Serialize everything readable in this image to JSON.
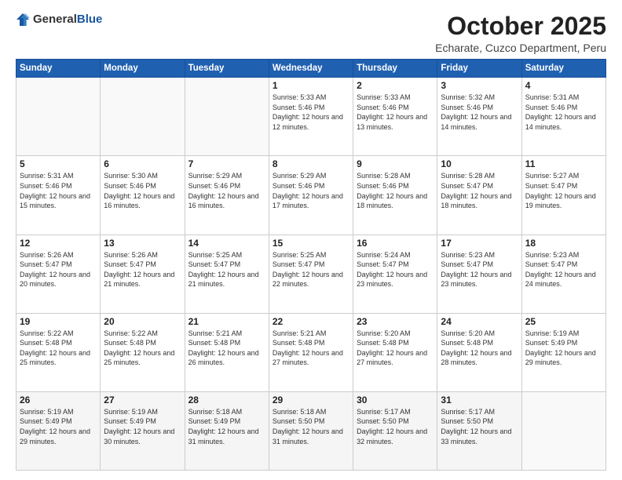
{
  "header": {
    "logo_general": "General",
    "logo_blue": "Blue",
    "month": "October 2025",
    "location": "Echarate, Cuzco Department, Peru"
  },
  "weekdays": [
    "Sunday",
    "Monday",
    "Tuesday",
    "Wednesday",
    "Thursday",
    "Friday",
    "Saturday"
  ],
  "weeks": [
    [
      {
        "day": "",
        "detail": ""
      },
      {
        "day": "",
        "detail": ""
      },
      {
        "day": "",
        "detail": ""
      },
      {
        "day": "1",
        "detail": "Sunrise: 5:33 AM\nSunset: 5:46 PM\nDaylight: 12 hours\nand 12 minutes."
      },
      {
        "day": "2",
        "detail": "Sunrise: 5:33 AM\nSunset: 5:46 PM\nDaylight: 12 hours\nand 13 minutes."
      },
      {
        "day": "3",
        "detail": "Sunrise: 5:32 AM\nSunset: 5:46 PM\nDaylight: 12 hours\nand 14 minutes."
      },
      {
        "day": "4",
        "detail": "Sunrise: 5:31 AM\nSunset: 5:46 PM\nDaylight: 12 hours\nand 14 minutes."
      }
    ],
    [
      {
        "day": "5",
        "detail": "Sunrise: 5:31 AM\nSunset: 5:46 PM\nDaylight: 12 hours\nand 15 minutes."
      },
      {
        "day": "6",
        "detail": "Sunrise: 5:30 AM\nSunset: 5:46 PM\nDaylight: 12 hours\nand 16 minutes."
      },
      {
        "day": "7",
        "detail": "Sunrise: 5:29 AM\nSunset: 5:46 PM\nDaylight: 12 hours\nand 16 minutes."
      },
      {
        "day": "8",
        "detail": "Sunrise: 5:29 AM\nSunset: 5:46 PM\nDaylight: 12 hours\nand 17 minutes."
      },
      {
        "day": "9",
        "detail": "Sunrise: 5:28 AM\nSunset: 5:46 PM\nDaylight: 12 hours\nand 18 minutes."
      },
      {
        "day": "10",
        "detail": "Sunrise: 5:28 AM\nSunset: 5:47 PM\nDaylight: 12 hours\nand 18 minutes."
      },
      {
        "day": "11",
        "detail": "Sunrise: 5:27 AM\nSunset: 5:47 PM\nDaylight: 12 hours\nand 19 minutes."
      }
    ],
    [
      {
        "day": "12",
        "detail": "Sunrise: 5:26 AM\nSunset: 5:47 PM\nDaylight: 12 hours\nand 20 minutes."
      },
      {
        "day": "13",
        "detail": "Sunrise: 5:26 AM\nSunset: 5:47 PM\nDaylight: 12 hours\nand 21 minutes."
      },
      {
        "day": "14",
        "detail": "Sunrise: 5:25 AM\nSunset: 5:47 PM\nDaylight: 12 hours\nand 21 minutes."
      },
      {
        "day": "15",
        "detail": "Sunrise: 5:25 AM\nSunset: 5:47 PM\nDaylight: 12 hours\nand 22 minutes."
      },
      {
        "day": "16",
        "detail": "Sunrise: 5:24 AM\nSunset: 5:47 PM\nDaylight: 12 hours\nand 23 minutes."
      },
      {
        "day": "17",
        "detail": "Sunrise: 5:23 AM\nSunset: 5:47 PM\nDaylight: 12 hours\nand 23 minutes."
      },
      {
        "day": "18",
        "detail": "Sunrise: 5:23 AM\nSunset: 5:47 PM\nDaylight: 12 hours\nand 24 minutes."
      }
    ],
    [
      {
        "day": "19",
        "detail": "Sunrise: 5:22 AM\nSunset: 5:48 PM\nDaylight: 12 hours\nand 25 minutes."
      },
      {
        "day": "20",
        "detail": "Sunrise: 5:22 AM\nSunset: 5:48 PM\nDaylight: 12 hours\nand 25 minutes."
      },
      {
        "day": "21",
        "detail": "Sunrise: 5:21 AM\nSunset: 5:48 PM\nDaylight: 12 hours\nand 26 minutes."
      },
      {
        "day": "22",
        "detail": "Sunrise: 5:21 AM\nSunset: 5:48 PM\nDaylight: 12 hours\nand 27 minutes."
      },
      {
        "day": "23",
        "detail": "Sunrise: 5:20 AM\nSunset: 5:48 PM\nDaylight: 12 hours\nand 27 minutes."
      },
      {
        "day": "24",
        "detail": "Sunrise: 5:20 AM\nSunset: 5:48 PM\nDaylight: 12 hours\nand 28 minutes."
      },
      {
        "day": "25",
        "detail": "Sunrise: 5:19 AM\nSunset: 5:49 PM\nDaylight: 12 hours\nand 29 minutes."
      }
    ],
    [
      {
        "day": "26",
        "detail": "Sunrise: 5:19 AM\nSunset: 5:49 PM\nDaylight: 12 hours\nand 29 minutes."
      },
      {
        "day": "27",
        "detail": "Sunrise: 5:19 AM\nSunset: 5:49 PM\nDaylight: 12 hours\nand 30 minutes."
      },
      {
        "day": "28",
        "detail": "Sunrise: 5:18 AM\nSunset: 5:49 PM\nDaylight: 12 hours\nand 31 minutes."
      },
      {
        "day": "29",
        "detail": "Sunrise: 5:18 AM\nSunset: 5:50 PM\nDaylight: 12 hours\nand 31 minutes."
      },
      {
        "day": "30",
        "detail": "Sunrise: 5:17 AM\nSunset: 5:50 PM\nDaylight: 12 hours\nand 32 minutes."
      },
      {
        "day": "31",
        "detail": "Sunrise: 5:17 AM\nSunset: 5:50 PM\nDaylight: 12 hours\nand 33 minutes."
      },
      {
        "day": "",
        "detail": ""
      }
    ]
  ]
}
